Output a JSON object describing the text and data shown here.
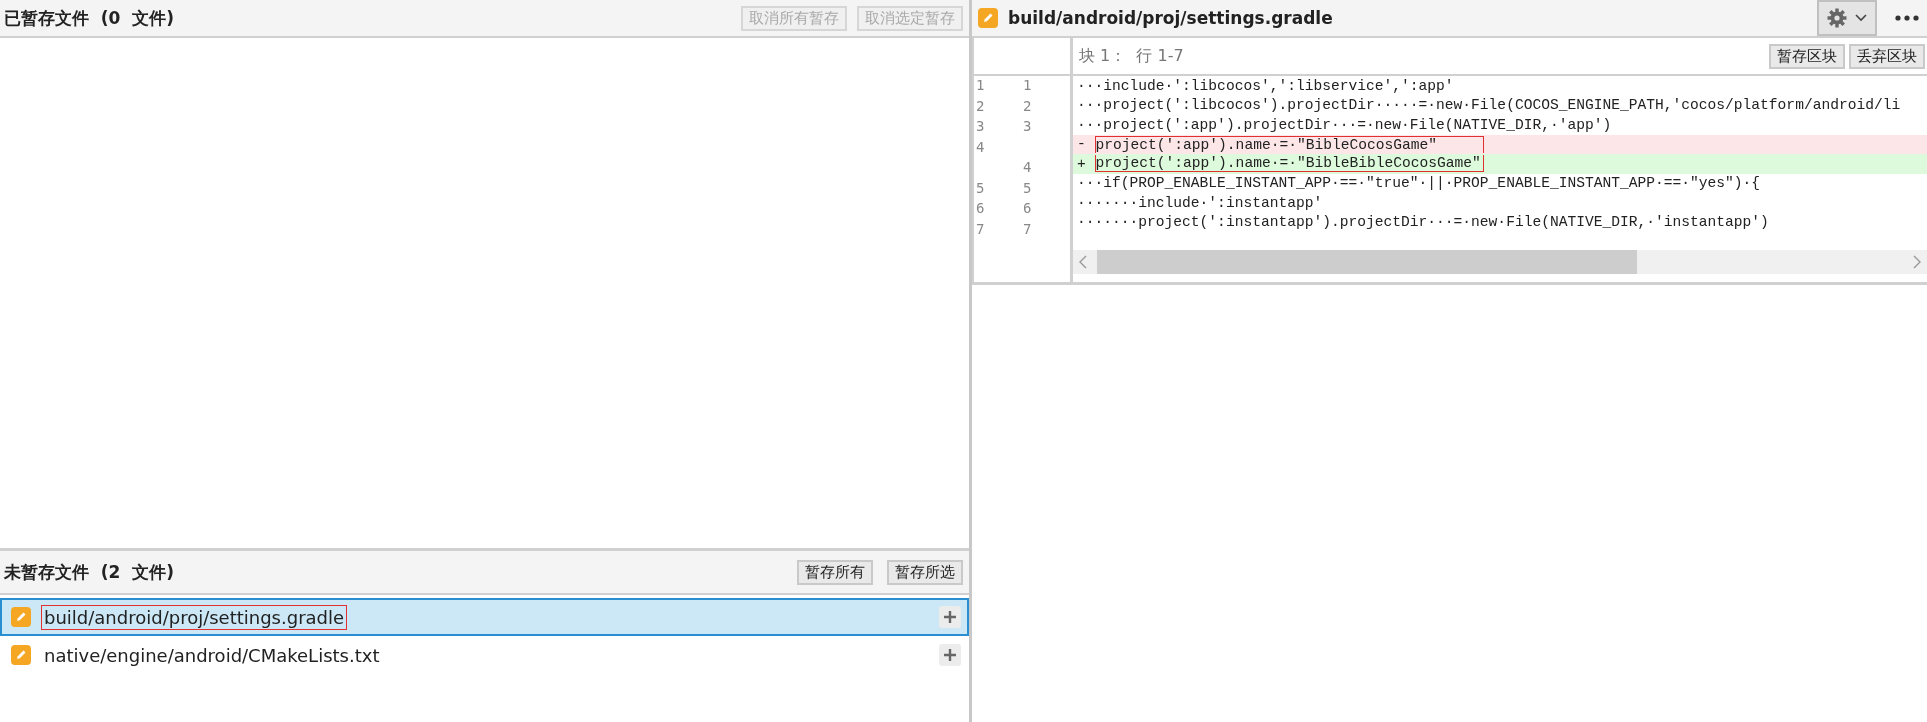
{
  "staged": {
    "title": "已暂存文件",
    "count": "(0  文件)",
    "buttons": [
      {
        "label": "取消所有暂存",
        "disabled": true
      },
      {
        "label": "取消选定暂存",
        "disabled": true
      }
    ]
  },
  "unstaged": {
    "title": "未暂存文件",
    "count": "(2  文件)",
    "buttons": [
      {
        "label": "暂存所有",
        "disabled": false
      },
      {
        "label": "暂存所选",
        "disabled": false
      }
    ],
    "files": [
      {
        "path": "build/android/proj/settings.gradle",
        "selected": true,
        "outlined": true
      },
      {
        "path": "native/engine/android/CMakeLists.txt",
        "selected": false,
        "outlined": false
      }
    ]
  },
  "diff": {
    "file": "build/android/proj/settings.gradle",
    "hunk": {
      "title": "块 1：  行 1-7",
      "buttons": [
        "暂存区块",
        "丢弃区块"
      ]
    },
    "lines": [
      {
        "kind": "context",
        "old": "1",
        "new": "1",
        "text": "···include·':libcocos',':libservice',':app'",
        "outlined": false
      },
      {
        "kind": "context",
        "old": "2",
        "new": "2",
        "text": "···project(':libcocos').projectDir·····=·new·File(COCOS_ENGINE_PATH,'cocos/platform/android/li",
        "outlined": false
      },
      {
        "kind": "context",
        "old": "3",
        "new": "3",
        "text": "···project(':app').projectDir···=·new·File(NATIVE_DIR,·'app')",
        "outlined": false
      },
      {
        "kind": "removed",
        "old": "4",
        "sign": "-",
        "text": "project(':app').name·=·\"BibleCocosGame\"",
        "outlined": true
      },
      {
        "kind": "added",
        "new": "4",
        "sign": "+",
        "text": "project(':app').name·=·\"BibleBibleCocosGame\"",
        "outlined": true
      },
      {
        "kind": "context",
        "old": "5",
        "new": "5",
        "text": "···if(PROP_ENABLE_INSTANT_APP·==·\"true\"·||·PROP_ENABLE_INSTANT_APP·==·\"yes\")·{",
        "outlined": false
      },
      {
        "kind": "context",
        "old": "6",
        "new": "6",
        "text": "·······include·':instantapp'",
        "outlined": false
      },
      {
        "kind": "context",
        "old": "7",
        "new": "7",
        "text": "·······project(':instantapp').projectDir···=·new·File(NATIVE_DIR,·'instantapp')",
        "outlined": false
      }
    ]
  }
}
